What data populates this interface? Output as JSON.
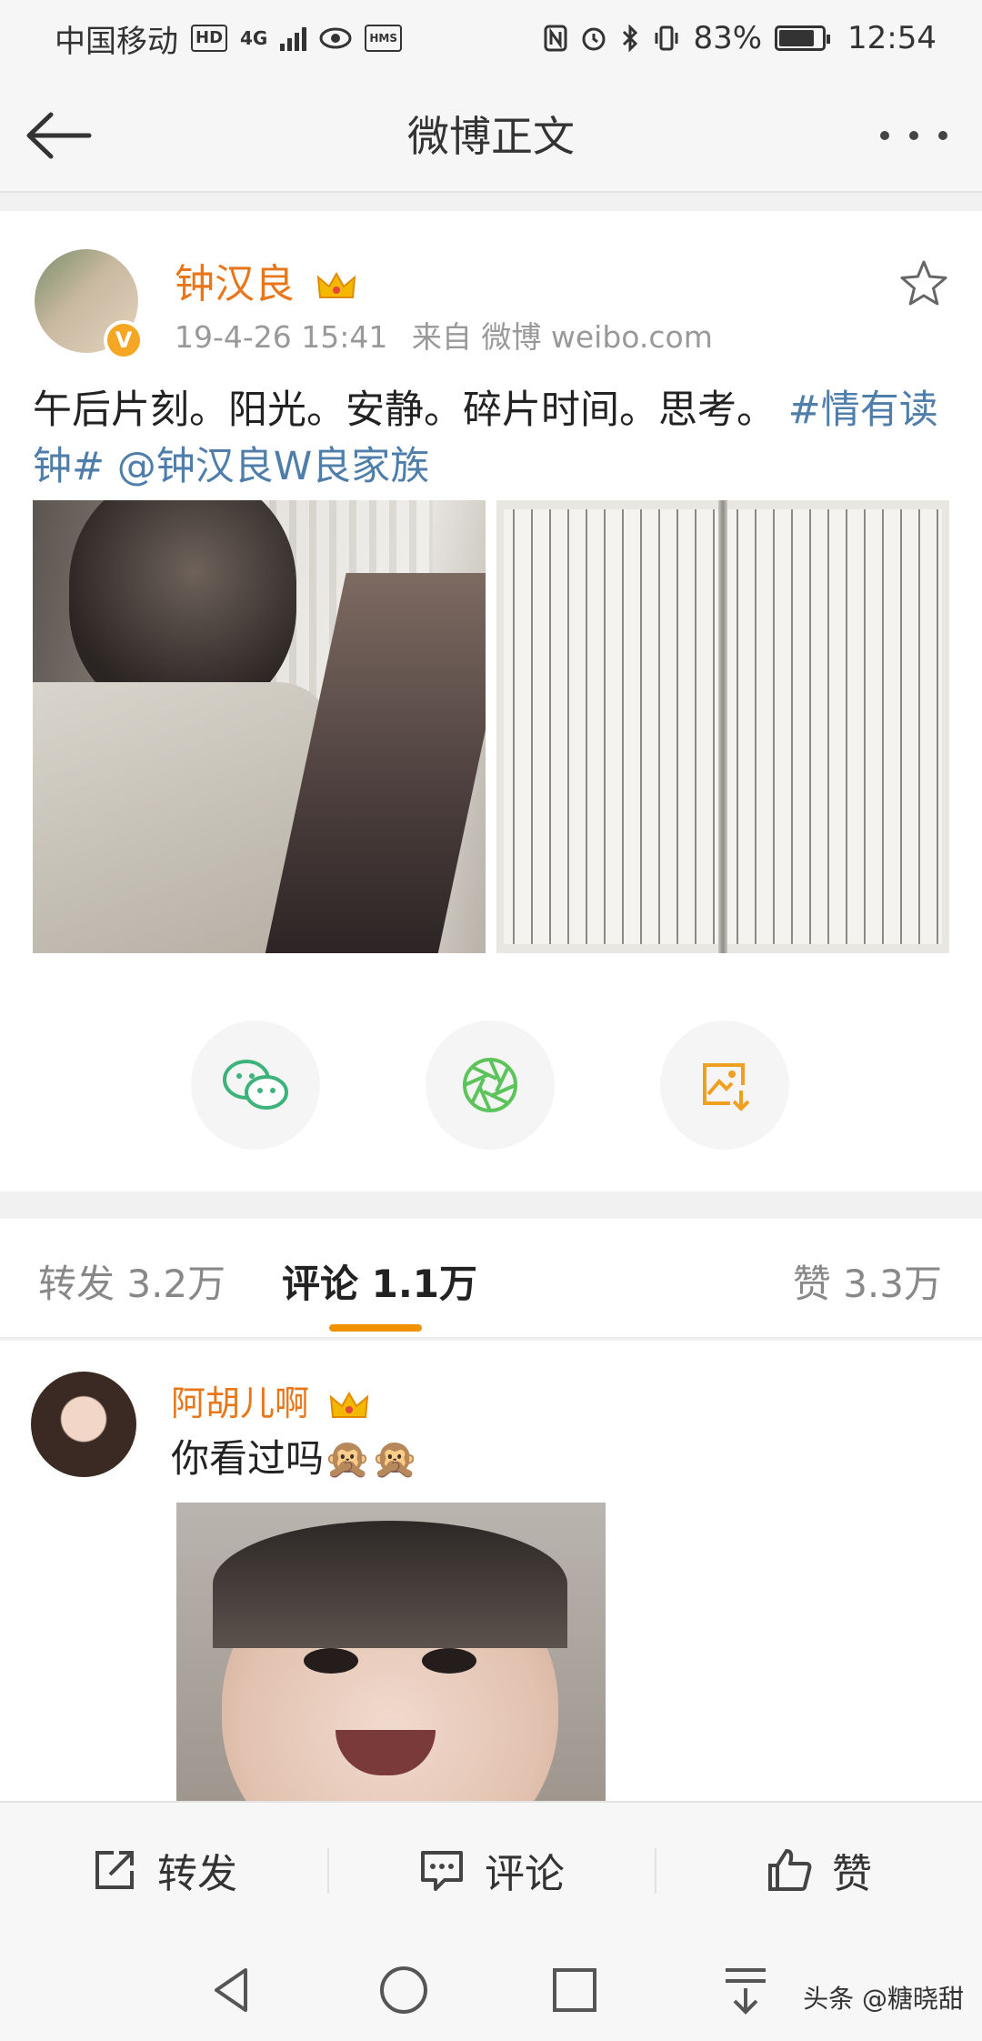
{
  "status_bar": {
    "carrier": "中国移动",
    "hd_badge": "HD",
    "network": "4G",
    "hms_badge": "HMS",
    "battery_percent": "83%",
    "time": "12:54",
    "battery_level": 0.83
  },
  "header": {
    "title": "微博正文"
  },
  "post": {
    "author": "钟汉良",
    "verified_mark": "V",
    "timestamp": "19-4-26 15:41",
    "source": "来自 微博 weibo.com",
    "text": "午后片刻。阳光。安静。碎片时间。思考。",
    "hashtag": "#情有读钟#",
    "mention": "@钟汉良W良家族",
    "images": [
      "photo-reading",
      "photo-book-pages"
    ]
  },
  "share": {
    "icons": [
      "wechat-icon",
      "moments-icon",
      "save-image-icon"
    ],
    "colors": {
      "wechat": "#3bb37a",
      "moments": "#5cc45a",
      "save": "#f0a020"
    }
  },
  "tabs": {
    "repost": "转发 3.2万",
    "comments": "评论 1.1万",
    "likes": "赞 3.3万",
    "active": "comments",
    "accent": "#f29100"
  },
  "comment": {
    "author": "阿胡儿啊",
    "text": "你看过吗🙊🙊"
  },
  "actions": {
    "repost": "转发",
    "comment": "评论",
    "like": "赞"
  },
  "watermark": "头条 @糖晓甜"
}
